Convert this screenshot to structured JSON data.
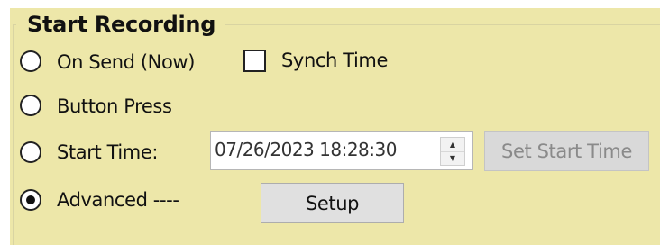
{
  "group": {
    "title": "Start Recording"
  },
  "options": {
    "on_send": {
      "label": "On Send (Now)",
      "selected": false
    },
    "button_press": {
      "label": "Button Press",
      "selected": false
    },
    "start_time": {
      "label": "Start Time:",
      "selected": false
    },
    "advanced": {
      "label": "Advanced ----",
      "selected": true
    }
  },
  "synch_time": {
    "label": "Synch Time",
    "checked": false
  },
  "start_time_picker": {
    "value": "07/26/2023 18:28:30"
  },
  "buttons": {
    "set_start_time": {
      "label": "Set Start Time",
      "enabled": false
    },
    "setup": {
      "label": "Setup",
      "enabled": true
    }
  },
  "colors": {
    "panel_background": "#ede7a9",
    "disabled_button": "#d9d9d9",
    "button": "#e0e0e0"
  }
}
